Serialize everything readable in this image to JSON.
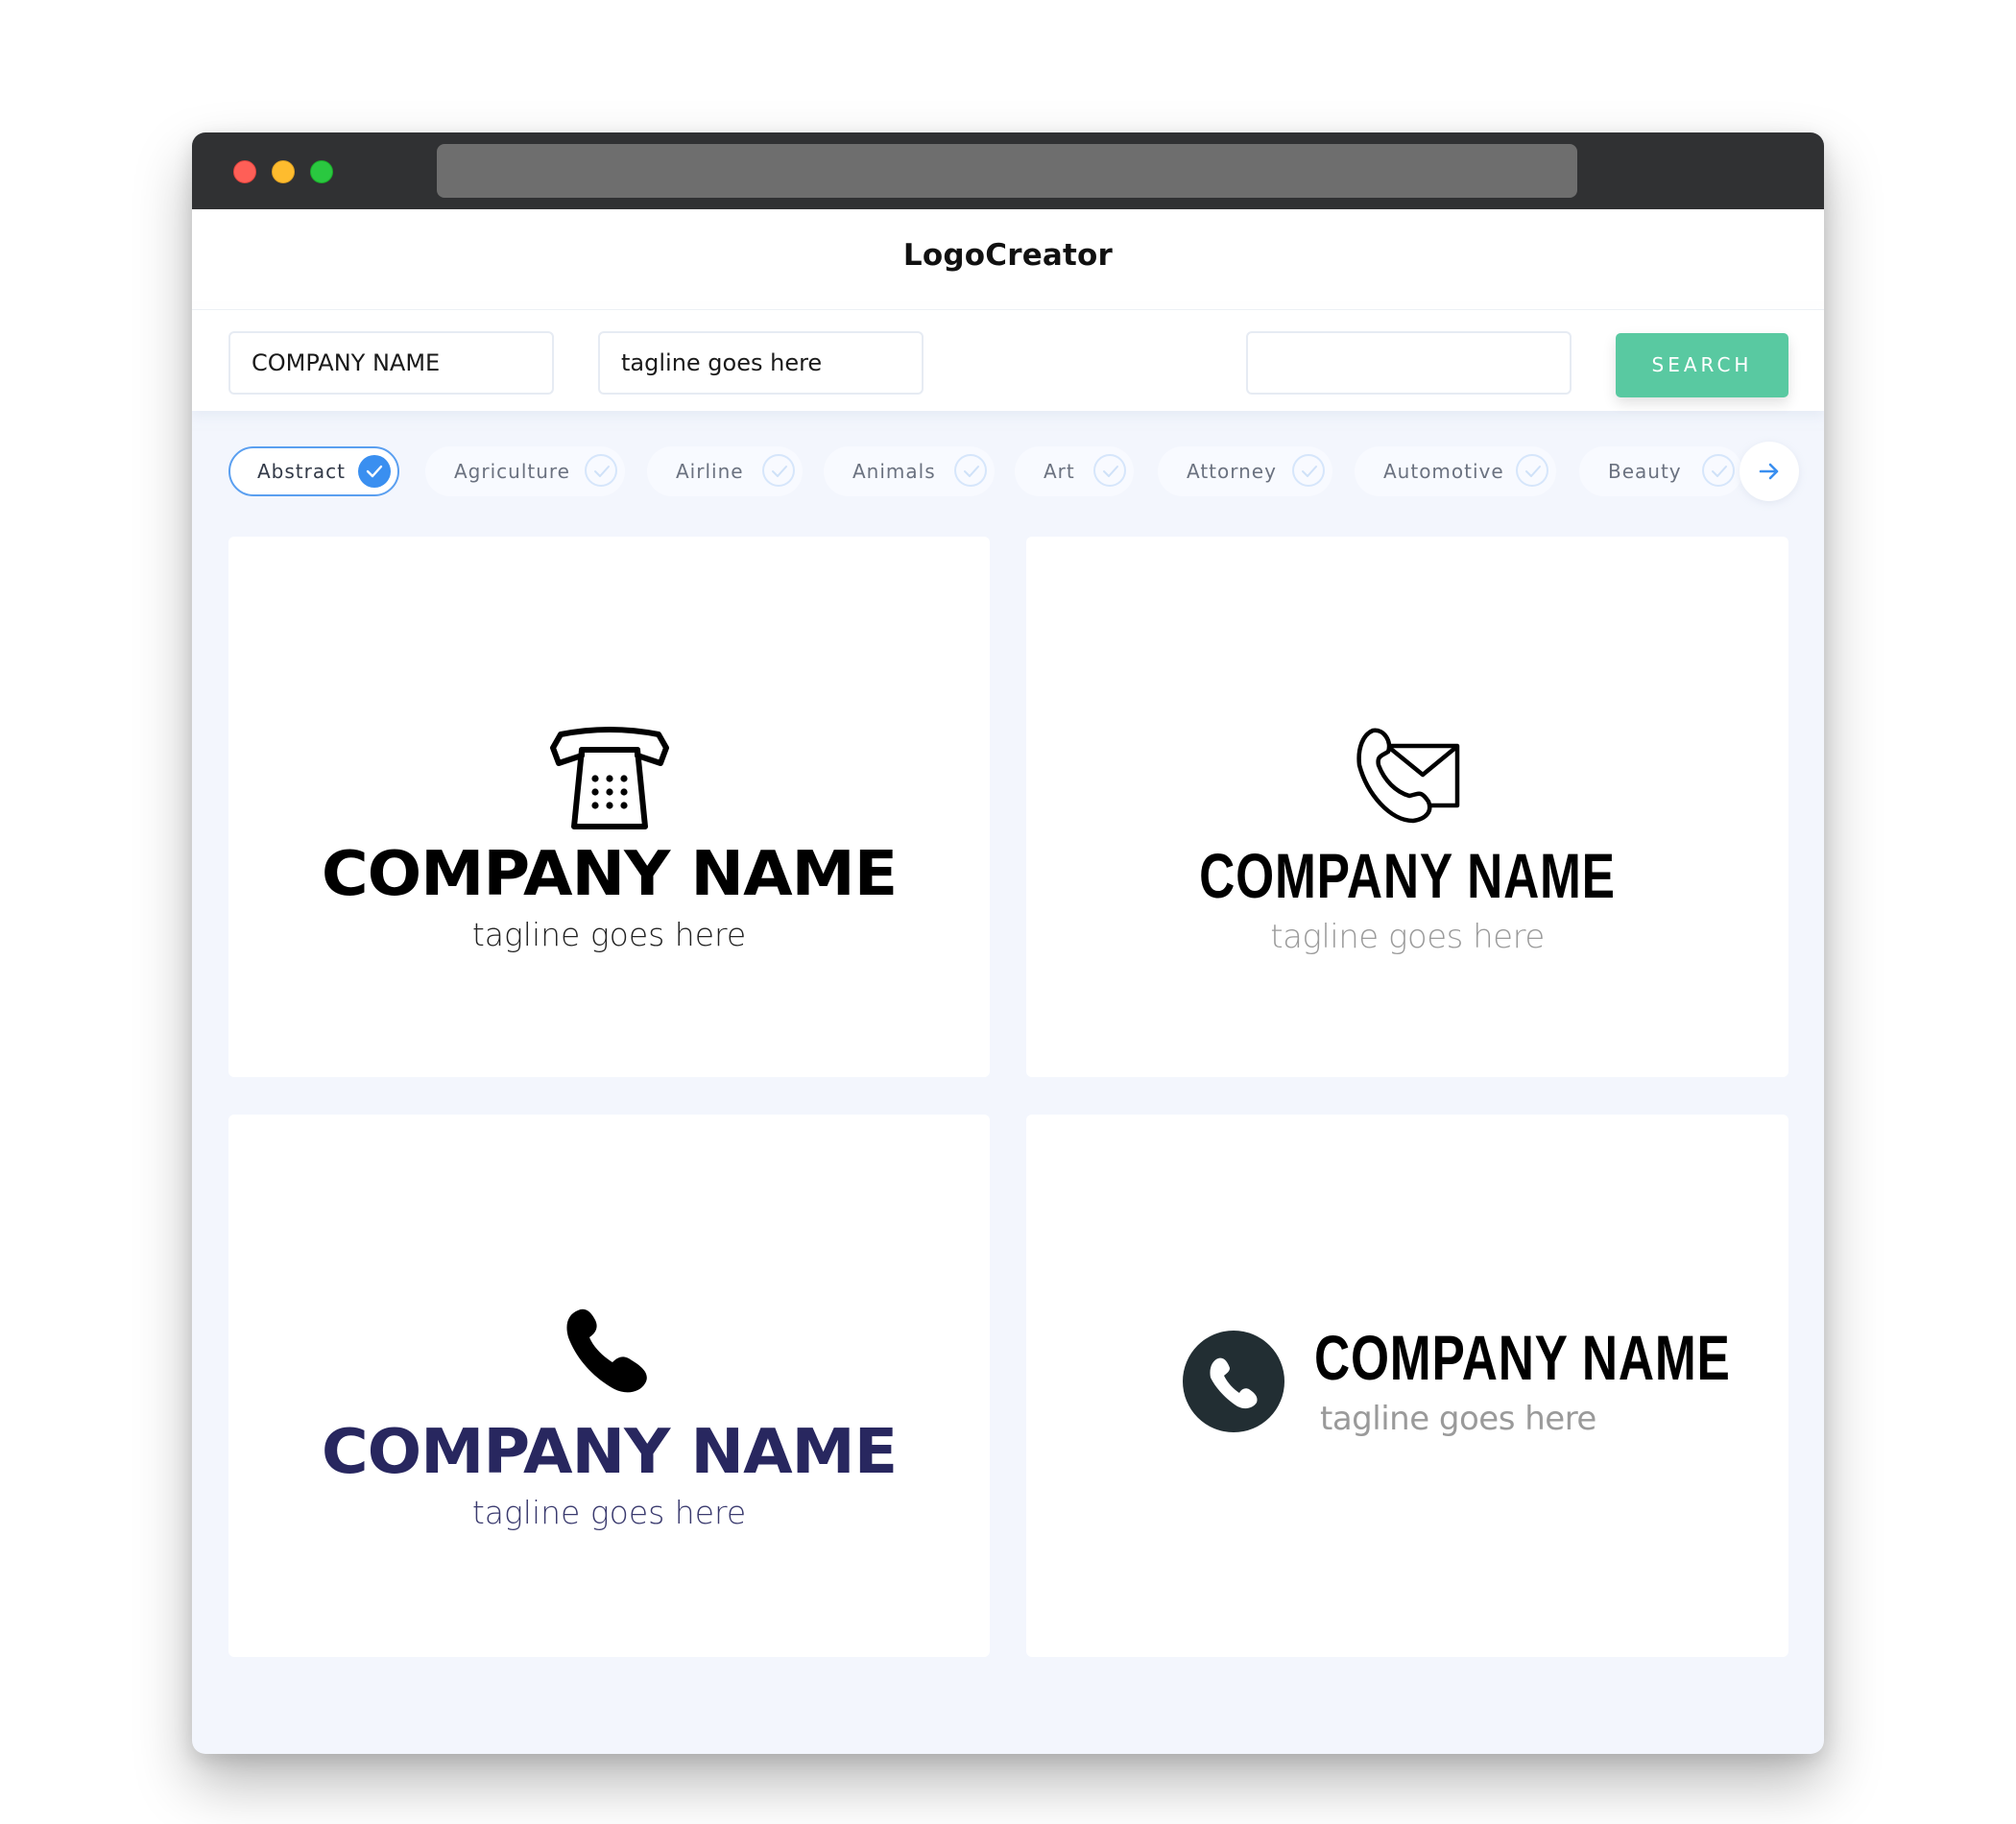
{
  "window": {
    "traffic_lights": [
      "close",
      "minimize",
      "maximize"
    ]
  },
  "header": {
    "brand": "LogoCreator"
  },
  "search": {
    "company_name_value": "COMPANY NAME",
    "tagline_value": "tagline goes here",
    "extra_value": "",
    "button_label": "SEARCH",
    "button_color": "#59c9a1"
  },
  "categories": {
    "items": [
      {
        "label": "Abstract",
        "selected": true
      },
      {
        "label": "Agriculture",
        "selected": false
      },
      {
        "label": "Airline",
        "selected": false
      },
      {
        "label": "Animals",
        "selected": false
      },
      {
        "label": "Art",
        "selected": false
      },
      {
        "label": "Attorney",
        "selected": false
      },
      {
        "label": "Automotive",
        "selected": false
      },
      {
        "label": "Beauty",
        "selected": false
      }
    ],
    "next_icon": "arrow-right-icon",
    "accent_color": "#3a8ff0"
  },
  "logos": [
    {
      "icon": "desk-telephone-icon",
      "name": "COMPANY NAME",
      "tagline": "tagline goes here",
      "name_color": "#000000"
    },
    {
      "icon": "phone-envelope-icon",
      "name": "COMPANY NAME",
      "tagline": "tagline goes here",
      "name_color": "#000000"
    },
    {
      "icon": "phone-handset-icon",
      "name": "COMPANY NAME",
      "tagline": "tagline goes here",
      "name_color": "#28275f"
    },
    {
      "icon": "phone-circle-icon",
      "name": "COMPANY NAME",
      "tagline": "tagline goes here",
      "name_color": "#000000",
      "icon_color": "#222e33"
    }
  ]
}
